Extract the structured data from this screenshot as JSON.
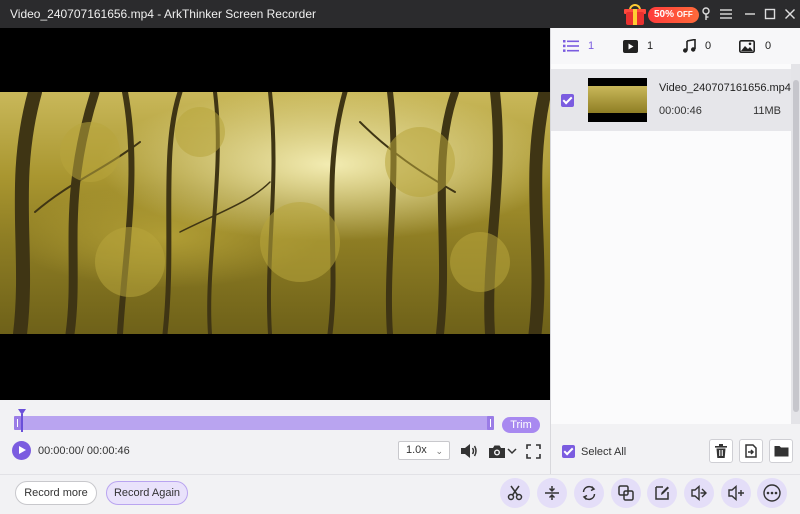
{
  "window": {
    "file_title": "Video_240707161656.mp4",
    "separator": " - ",
    "app_title": "ArkThinker Screen Recorder",
    "promo": "50%",
    "promo_suffix": "OFF"
  },
  "colors": {
    "accent": "#7b5ce0",
    "track": "#b9a4f0",
    "titlebar": "#2b2b2d"
  },
  "player": {
    "trim_label": "Trim",
    "timecode": "00:00:00/ 00:00:46",
    "speed": "1.0x",
    "progress_fraction": 0.0
  },
  "tabs": [
    {
      "icon": "list-icon",
      "count": "1"
    },
    {
      "icon": "video-icon",
      "count": "1"
    },
    {
      "icon": "audio-icon",
      "count": "0"
    },
    {
      "icon": "image-icon",
      "count": "0"
    }
  ],
  "files": [
    {
      "name": "Video_240707161656.mp4",
      "duration": "00:00:46",
      "size": "11MB",
      "checked": true
    }
  ],
  "panel": {
    "select_all": "Select All"
  },
  "bottom": {
    "record_more": "Record more",
    "record_again": "Record Again",
    "tools": [
      "scissors-icon",
      "compress-icon",
      "convert-icon",
      "merge-icon",
      "edit-icon",
      "audio-boost-icon",
      "volume-icon",
      "more-icon"
    ]
  }
}
